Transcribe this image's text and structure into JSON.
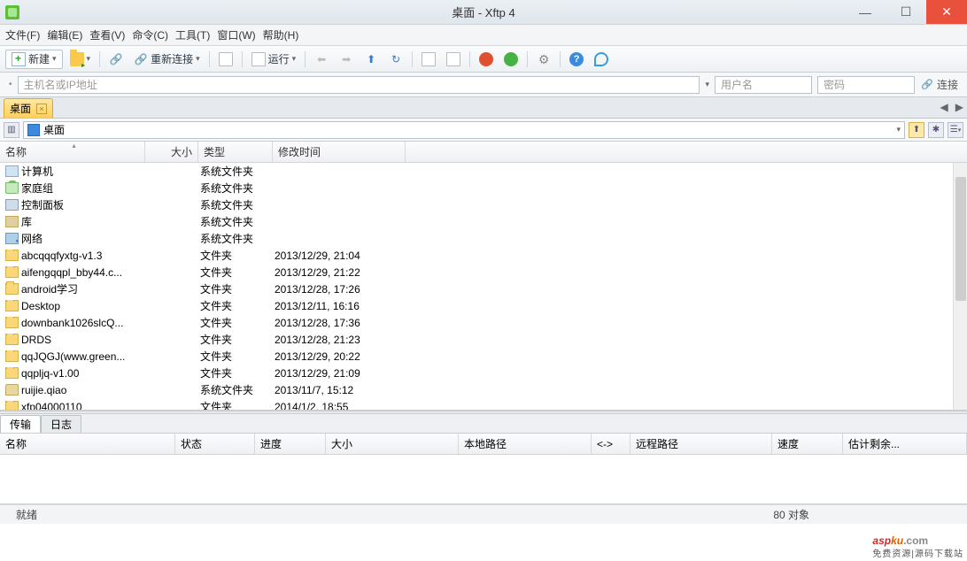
{
  "window": {
    "title": "桌面 - Xftp 4"
  },
  "menu": {
    "file": "文件(F)",
    "edit": "编辑(E)",
    "view": "查看(V)",
    "cmd": "命令(C)",
    "tool": "工具(T)",
    "window": "窗口(W)",
    "help": "帮助(H)"
  },
  "toolbar": {
    "new": "新建",
    "reconnect": "重新连接",
    "run": "运行"
  },
  "connectbar": {
    "host_ph": "主机名或IP地址",
    "user_ph": "用户名",
    "pass_ph": "密码",
    "connect": "连接"
  },
  "tab": {
    "label": "桌面"
  },
  "pathbar": {
    "label": "桌面"
  },
  "columns": {
    "name": "名称",
    "size": "大小",
    "type": "类型",
    "date": "修改时间"
  },
  "files": [
    {
      "icon": "comp",
      "name": "计算机",
      "type": "系统文件夹",
      "date": ""
    },
    {
      "icon": "home",
      "name": "家庭组",
      "type": "系统文件夹",
      "date": ""
    },
    {
      "icon": "panel",
      "name": "控制面板",
      "type": "系统文件夹",
      "date": ""
    },
    {
      "icon": "lib",
      "name": "库",
      "type": "系统文件夹",
      "date": ""
    },
    {
      "icon": "net",
      "name": "网络",
      "type": "系统文件夹",
      "date": ""
    },
    {
      "icon": "fold",
      "name": "abcqqqfyxtg-v1.3",
      "type": "文件夹",
      "date": "2013/12/29, 21:04"
    },
    {
      "icon": "fold",
      "name": "aifengqqpl_bby44.c...",
      "type": "文件夹",
      "date": "2013/12/29, 21:22"
    },
    {
      "icon": "fold",
      "name": "android学习",
      "type": "文件夹",
      "date": "2013/12/28, 17:26"
    },
    {
      "icon": "fold",
      "name": "Desktop",
      "type": "文件夹",
      "date": "2013/12/11, 16:16"
    },
    {
      "icon": "fold",
      "name": "downbank1026slcQ...",
      "type": "文件夹",
      "date": "2013/12/28, 17:36"
    },
    {
      "icon": "fold",
      "name": "DRDS",
      "type": "文件夹",
      "date": "2013/12/28, 21:23"
    },
    {
      "icon": "fold",
      "name": "qqJQGJ(www.green...",
      "type": "文件夹",
      "date": "2013/12/29, 20:22"
    },
    {
      "icon": "fold",
      "name": "qqpljq-v1.00",
      "type": "文件夹",
      "date": "2013/12/29, 21:09"
    },
    {
      "icon": "user",
      "name": "ruijie.qiao",
      "type": "系统文件夹",
      "date": "2013/11/7, 15:12"
    },
    {
      "icon": "fold",
      "name": "xfp04000110",
      "type": "文件夹",
      "date": "2014/1/2, 18:55"
    }
  ],
  "transfertabs": {
    "transfer": "传输",
    "log": "日志"
  },
  "transfercols": {
    "name": "名称",
    "status": "状态",
    "progress": "进度",
    "size": "大小",
    "localpath": "本地路径",
    "dir": "<->",
    "remotepath": "远程路径",
    "speed": "速度",
    "eta": "估计剩余..."
  },
  "status": {
    "ready": "就绪",
    "objects": "80 对象"
  }
}
